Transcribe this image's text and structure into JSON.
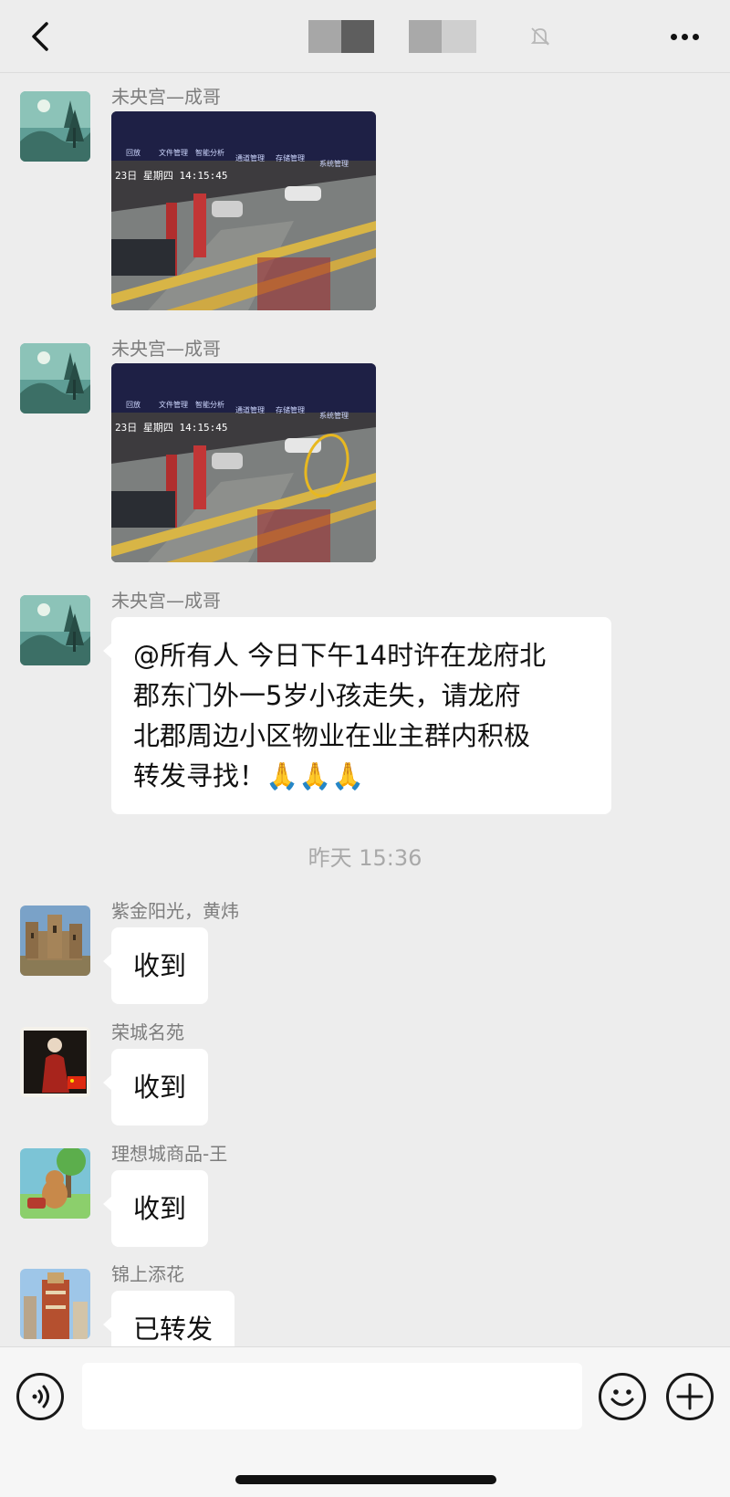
{
  "header": {
    "back_icon": "chevron-left-icon",
    "mute_icon": "bell-mute-icon",
    "more_icon": "ellipsis-icon"
  },
  "messages": [
    {
      "sender": "未央宫—成哥",
      "type": "image",
      "photo_time": "23日 星期四  14:15:45"
    },
    {
      "sender": "未央宫—成哥",
      "type": "image",
      "photo_time": "23日 星期四  14:15:45"
    },
    {
      "sender": "未央宫—成哥",
      "type": "text",
      "lines": [
        "@所有人 今日下午14时许在龙府北",
        "郡东门外一5岁小孩走失，请龙府",
        "北郡周边小区物业在业主群内积极",
        "转发寻找！🙏🙏🙏"
      ]
    }
  ],
  "timestamp": "昨天 15:36",
  "replies": [
    {
      "sender": "紫金阳光，黄炜",
      "text": "收到"
    },
    {
      "sender": "荣城名苑",
      "text": "收到"
    },
    {
      "sender": "理想城商品-王",
      "text": "收到"
    },
    {
      "sender": "锦上添花",
      "text": "已转发"
    }
  ],
  "input_bar": {
    "voice_icon": "voice-icon",
    "emoji_icon": "emoji-icon",
    "plus_icon": "plus-icon",
    "input_value": ""
  },
  "photo_toolbar": [
    "回放",
    "文件管理",
    "智能分析",
    "通道管理",
    "存储管理",
    "系统管理"
  ]
}
